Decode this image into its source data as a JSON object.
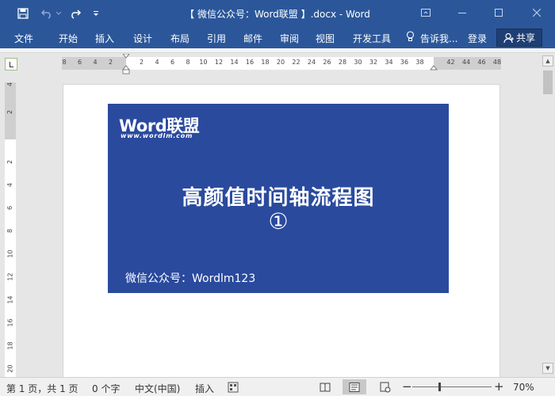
{
  "titlebar": {
    "title": "【 微信公众号：Word联盟 】.docx - Word",
    "icons": [
      "save-icon",
      "undo-icon",
      "redo-icon",
      "customize-qat-icon",
      "ribbon-display-icon",
      "minimize-icon",
      "maximize-icon",
      "close-icon"
    ]
  },
  "tabs": {
    "file": "文件",
    "home": "开始",
    "insert": "插入",
    "design": "设计",
    "layout": "布局",
    "references": "引用",
    "mailings": "邮件",
    "review": "审阅",
    "view": "视图",
    "developer": "开发工具",
    "tell_me": "告诉我...",
    "signin": "登录",
    "share": "共享"
  },
  "hruler": {
    "left_numbers": [
      "8",
      "6",
      "4",
      "2"
    ],
    "right_numbers": [
      "2",
      "4",
      "6",
      "8",
      "10",
      "12",
      "14",
      "16",
      "18",
      "20",
      "22",
      "24",
      "26",
      "28",
      "30",
      "32",
      "34",
      "36",
      "38",
      "42",
      "44",
      "46",
      "48"
    ]
  },
  "vruler": {
    "top_numbers": [
      "4",
      "2"
    ],
    "numbers": [
      "2",
      "4",
      "6",
      "8",
      "10",
      "12",
      "14",
      "16",
      "18",
      "20"
    ]
  },
  "document": {
    "logo_text": "Word联盟",
    "logo_sub": "www.wordlm.com",
    "banner_title": "高颜值时间轴流程图",
    "banner_symbol": "①",
    "banner_footer": "微信公众号：Wordlm123",
    "banner_color": "#2a4a9e"
  },
  "statusbar": {
    "page": "第 1 页，共 1 页",
    "words": "0 个字",
    "language": "中文(中国)",
    "insert_mode": "插入",
    "zoom_out": "−",
    "zoom_in": "+",
    "zoom": "70%"
  },
  "colors": {
    "accent": "#2b579a"
  }
}
